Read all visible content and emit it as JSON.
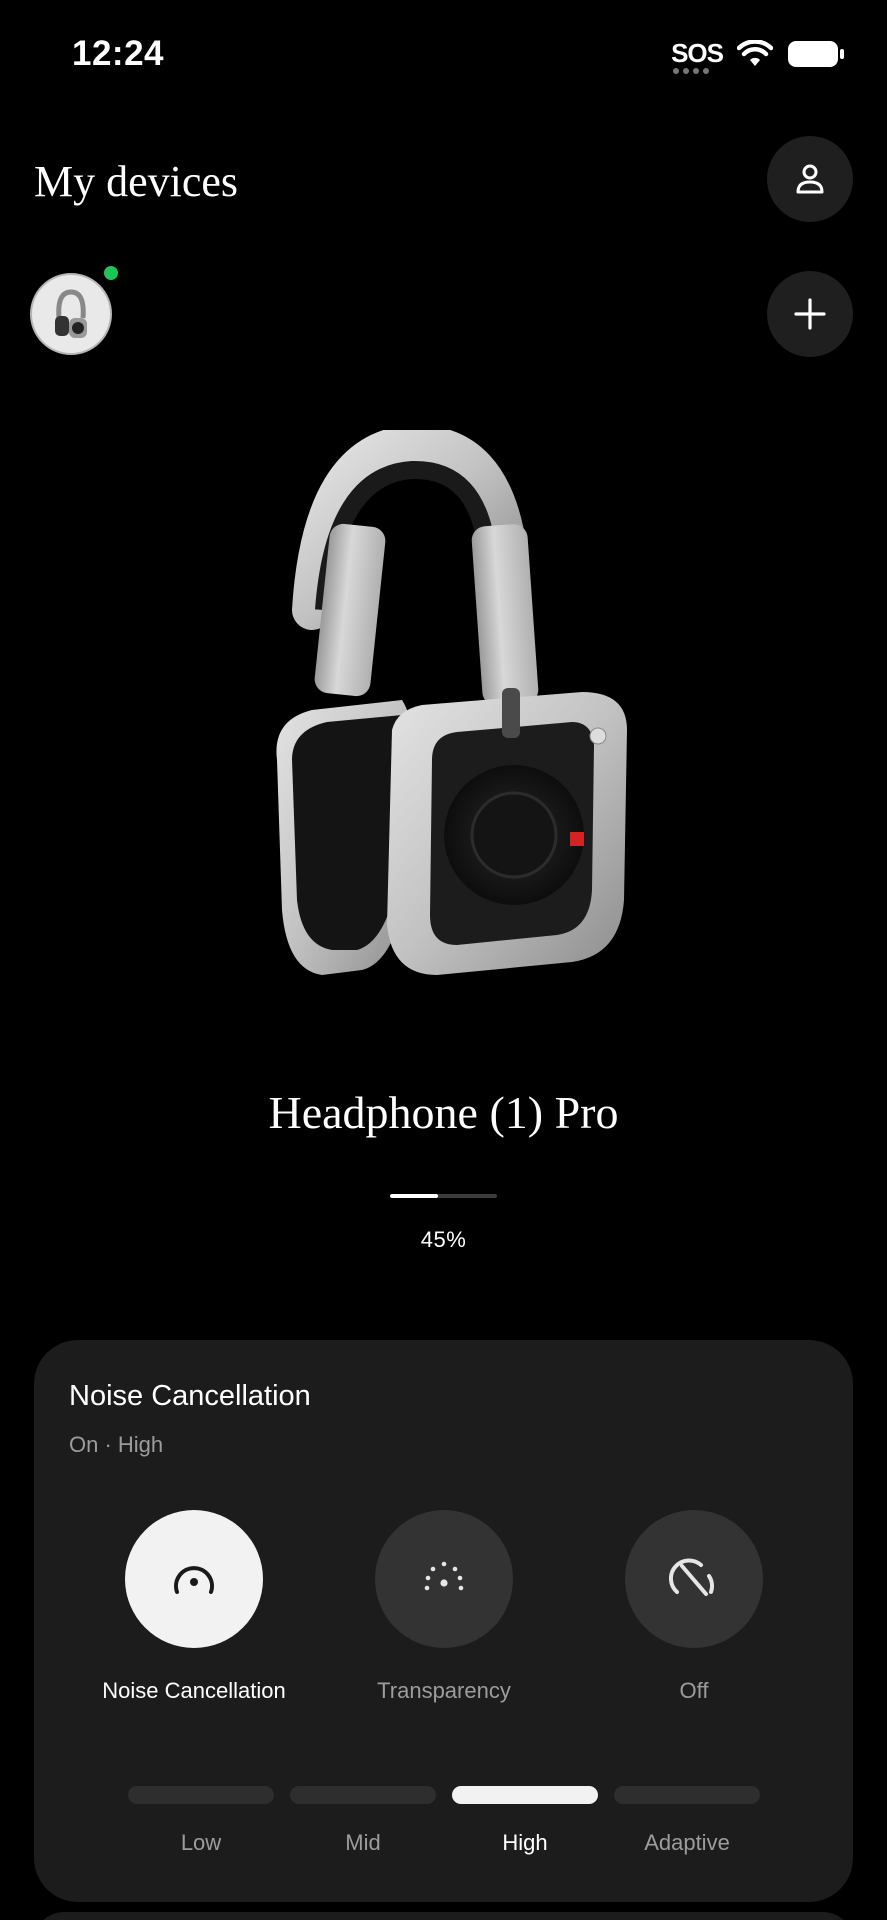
{
  "status_bar": {
    "time": "12:24",
    "sos": "SOS"
  },
  "header": {
    "title": "My devices"
  },
  "device": {
    "name": "Headphone (1) Pro",
    "battery_fraction": 0.45,
    "battery_text": "45%",
    "online_color": "#1fc456"
  },
  "noise_card": {
    "title": "Noise Cancellation",
    "subtitle": "On · High",
    "modes": [
      {
        "label": "Noise Cancellation",
        "icon": "noise-cancellation-icon",
        "active": true
      },
      {
        "label": "Transparency",
        "icon": "transparency-icon",
        "active": false
      },
      {
        "label": "Off",
        "icon": "anc-off-icon",
        "active": false
      }
    ],
    "levels": [
      {
        "label": "Low",
        "active": false
      },
      {
        "label": "Mid",
        "active": false
      },
      {
        "label": "High",
        "active": true
      },
      {
        "label": "Adaptive",
        "active": false
      }
    ]
  }
}
